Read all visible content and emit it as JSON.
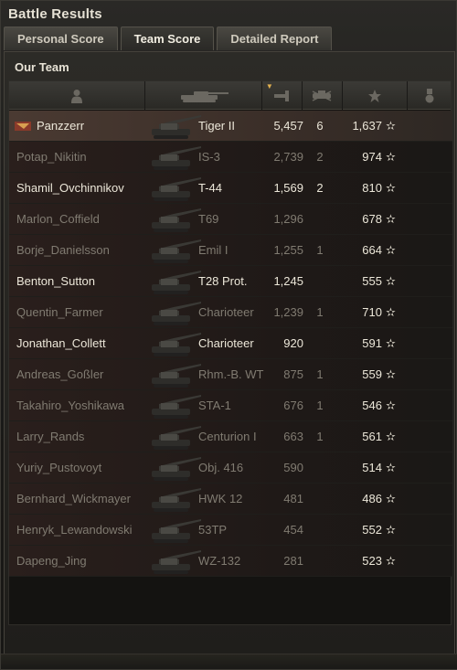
{
  "window": {
    "title": "Battle Results"
  },
  "tabs": [
    {
      "label": "Personal Score",
      "active": false
    },
    {
      "label": "Team Score",
      "active": true
    },
    {
      "label": "Detailed Report",
      "active": false
    }
  ],
  "team": {
    "title": "Our Team"
  },
  "columns": {
    "player_icon": "player-icon",
    "tank_icon": "tank-silhouette-icon",
    "damage_icon": "damage-icon",
    "kills_icon": "destroyed-tank-icon",
    "xp_icon": "star-icon",
    "medal_icon": "medal-icon"
  },
  "rows": [
    {
      "player": "Panzzerr",
      "tank": "Tiger II",
      "damage": "5,457",
      "kills": "6",
      "xp": "1,637",
      "self": true,
      "tone": "bright"
    },
    {
      "player": "Potap_Nikitin",
      "tank": "IS-3",
      "damage": "2,739",
      "kills": "2",
      "xp": "974",
      "tone": "dim"
    },
    {
      "player": "Shamil_Ovchinnikov",
      "tank": "T-44",
      "damage": "1,569",
      "kills": "2",
      "xp": "810",
      "tone": "bright"
    },
    {
      "player": "Marlon_Coffield",
      "tank": "T69",
      "damage": "1,296",
      "kills": "",
      "xp": "678",
      "tone": "dim"
    },
    {
      "player": "Borje_Danielsson",
      "tank": "Emil I",
      "damage": "1,255",
      "kills": "1",
      "xp": "664",
      "tone": "dim"
    },
    {
      "player": "Benton_Sutton",
      "tank": "T28 Prot.",
      "damage": "1,245",
      "kills": "",
      "xp": "555",
      "tone": "bright"
    },
    {
      "player": "Quentin_Farmer",
      "tank": "Charioteer",
      "damage": "1,239",
      "kills": "1",
      "xp": "710",
      "tone": "dim"
    },
    {
      "player": "Jonathan_Collett",
      "tank": "Charioteer",
      "damage": "920",
      "kills": "",
      "xp": "591",
      "tone": "bright"
    },
    {
      "player": "Andreas_Goßler",
      "tank": "Rhm.-B. WT",
      "damage": "875",
      "kills": "1",
      "xp": "559",
      "tone": "dim"
    },
    {
      "player": "Takahiro_Yoshikawa",
      "tank": "STA-1",
      "damage": "676",
      "kills": "1",
      "xp": "546",
      "tone": "dim"
    },
    {
      "player": "Larry_Rands",
      "tank": "Centurion I",
      "damage": "663",
      "kills": "1",
      "xp": "561",
      "tone": "dim"
    },
    {
      "player": "Yuriy_Pustovoyt",
      "tank": "Obj. 416",
      "damage": "590",
      "kills": "",
      "xp": "514",
      "tone": "dim"
    },
    {
      "player": "Bernhard_Wickmayer",
      "tank": "HWK 12",
      "damage": "481",
      "kills": "",
      "xp": "486",
      "tone": "dim"
    },
    {
      "player": "Henryk_Lewandowski",
      "tank": "53TP",
      "damage": "454",
      "kills": "",
      "xp": "552",
      "tone": "dim"
    },
    {
      "player": "Dapeng_Jing",
      "tank": "WZ-132",
      "damage": "281",
      "kills": "",
      "xp": "523",
      "tone": "dim"
    }
  ],
  "star_glyph": "✫",
  "colors": {
    "self_row": "#4a3a32",
    "accent": "#e0b050"
  }
}
